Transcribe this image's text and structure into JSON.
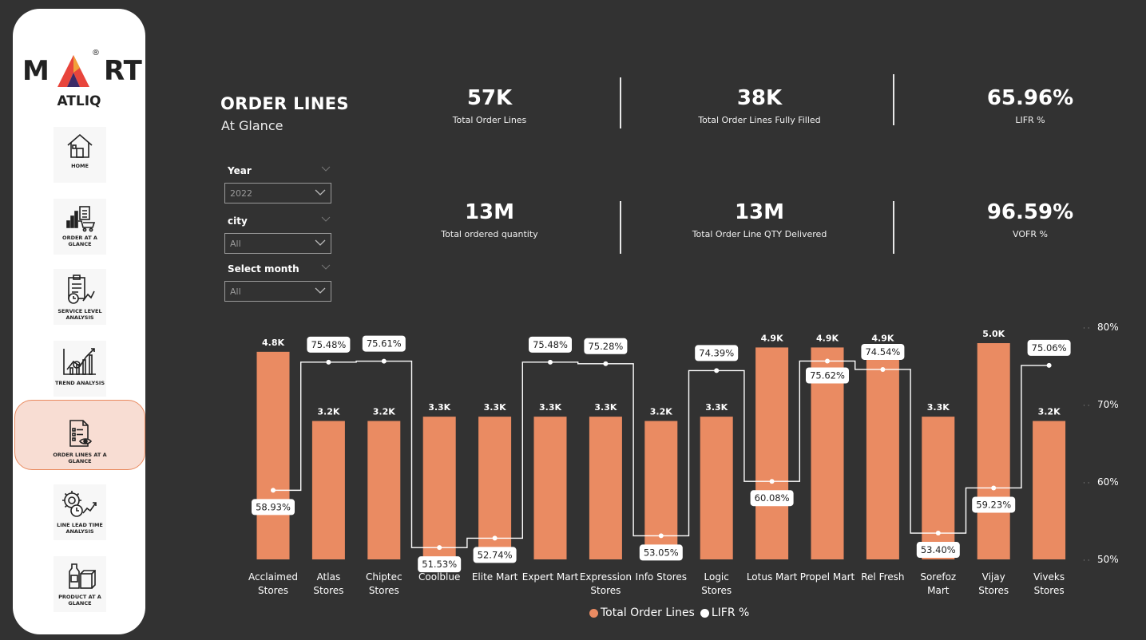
{
  "brand": {
    "name_left": "M",
    "name_right": "RT",
    "sub": "ATLIQ",
    "registered": "®"
  },
  "colors": {
    "bar": "#ea8b62",
    "background": "#323232",
    "active_nav": "#f8ddd3"
  },
  "nav": [
    {
      "label": "HOME",
      "icon": "home-icon"
    },
    {
      "label": "ORDER AT A GLANCE",
      "icon": "cart-chart-icon"
    },
    {
      "label": "SERVICE LEVEL ANALYSIS",
      "icon": "clipboard-clock-icon"
    },
    {
      "label": "TREND ANALYSIS",
      "icon": "trend-chart-icon"
    },
    {
      "label": "ORDER LINES AT A GLANCE",
      "icon": "document-eye-icon",
      "active": true
    },
    {
      "label": "LINE LEAD TIME ANALYSIS",
      "icon": "gear-clock-icon"
    },
    {
      "label": "PRODUCT AT A GLANCE",
      "icon": "product-bottle-icon"
    }
  ],
  "header": {
    "title": "ORDER LINES",
    "subtitle": "At Glance"
  },
  "filters": [
    {
      "label": "Year",
      "value": "2022"
    },
    {
      "label": "city",
      "value": "All"
    },
    {
      "label": "Select month",
      "value": "All"
    }
  ],
  "kpis": [
    {
      "value": "57K",
      "label": "Total Order Lines"
    },
    {
      "value": "38K",
      "label": "Total Order Lines Fully Filled"
    },
    {
      "value": "65.96%",
      "label": "LIFR %"
    },
    {
      "value": "13M",
      "label": "Total ordered quantity"
    },
    {
      "value": "13M",
      "label": "Total Order Line QTY Delivered"
    },
    {
      "value": "96.59%",
      "label": "VOFR %"
    }
  ],
  "chart_data": {
    "type": "bar",
    "categories": [
      "Acclaimed Stores",
      "Atlas Stores",
      "Chiptec Stores",
      "Coolblue",
      "Elite Mart",
      "Expert Mart",
      "Expression Stores",
      "Info Stores",
      "Logic Stores",
      "Lotus Mart",
      "Propel Mart",
      "Rel Fresh",
      "Sorefoz Mart",
      "Vijay Stores",
      "Viveks Stores"
    ],
    "series": [
      {
        "name": "Total Order Lines",
        "kind": "bar",
        "values": [
          4800,
          3200,
          3200,
          3300,
          3300,
          3300,
          3300,
          3200,
          3300,
          4900,
          4900,
          4900,
          3300,
          5000,
          3200
        ],
        "labels": [
          "4.8K",
          "3.2K",
          "3.2K",
          "3.3K",
          "3.3K",
          "3.3K",
          "3.3K",
          "3.2K",
          "3.3K",
          "4.9K",
          "4.9K",
          "4.9K",
          "3.3K",
          "5.0K",
          "3.2K"
        ]
      },
      {
        "name": "LIFR %",
        "kind": "step-line",
        "values": [
          58.93,
          75.48,
          75.61,
          51.53,
          52.74,
          75.48,
          75.28,
          53.05,
          74.39,
          60.08,
          75.62,
          74.54,
          53.4,
          59.23,
          75.06
        ],
        "labels": [
          "58.93%",
          "75.48%",
          "75.61%",
          "51.53%",
          "52.74%",
          "75.48%",
          "75.28%",
          "53.05%",
          "74.39%",
          "60.08%",
          "75.62%",
          "74.54%",
          "53.40%",
          "59.23%",
          "75.06%"
        ]
      }
    ],
    "y2_ticks": [
      "80%",
      "70%",
      "60%",
      "50%"
    ],
    "y2lim": [
      50,
      80
    ],
    "legend": "bottom-center"
  },
  "legend": {
    "bar": "Total Order Lines",
    "line": "LIFR %"
  }
}
